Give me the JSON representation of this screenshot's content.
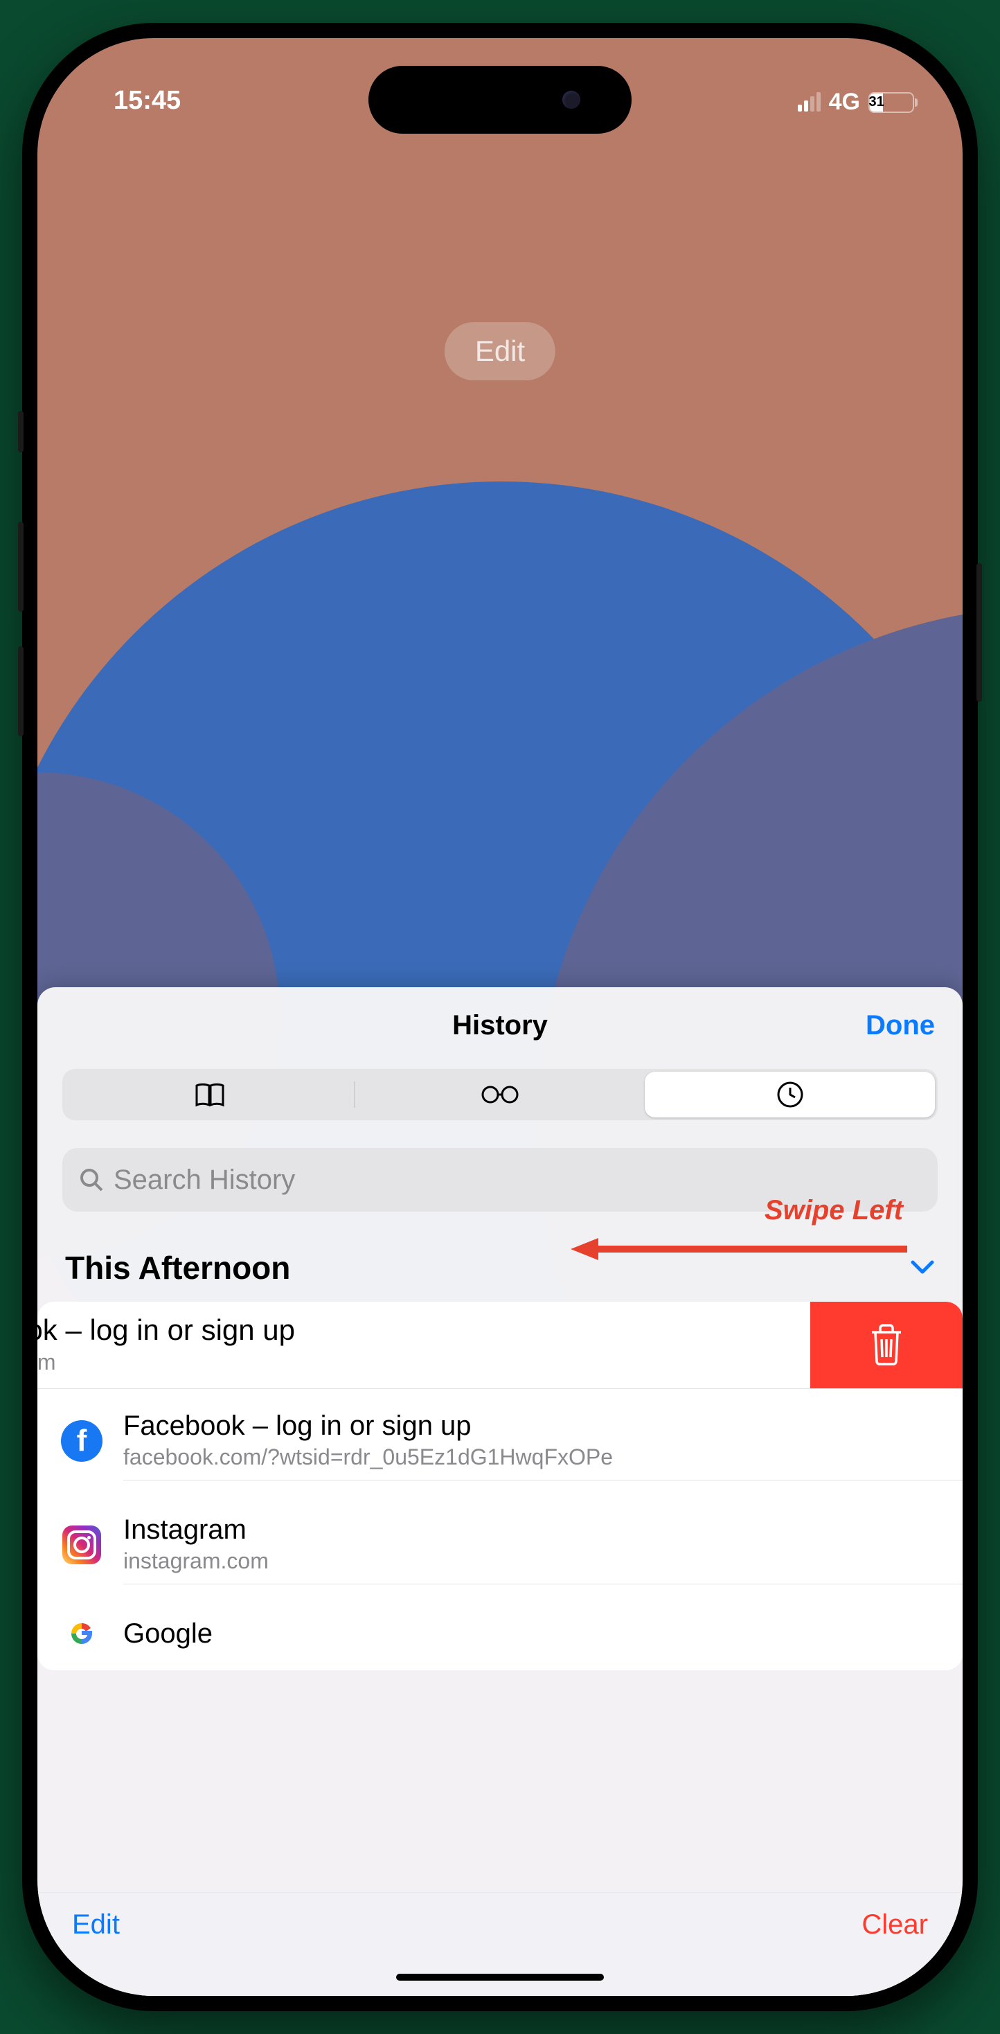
{
  "status": {
    "time": "15:45",
    "network": "4G",
    "battery_pct": "31"
  },
  "wallpaper": {
    "edit_label": "Edit"
  },
  "sheet": {
    "title": "History",
    "done_label": "Done",
    "search_placeholder": "Search History",
    "section_title": "This Afternoon"
  },
  "annotation": {
    "label": "Swipe Left"
  },
  "history": {
    "swiped": {
      "title": "acebook – log in or sign up",
      "subtitle": "ebook.com"
    },
    "items": [
      {
        "title": "Facebook – log in or sign up",
        "subtitle": "facebook.com/?wtsid=rdr_0u5Ez1dG1HwqFxOPe",
        "icon": "facebook"
      },
      {
        "title": "Instagram",
        "subtitle": "instagram.com",
        "icon": "instagram"
      },
      {
        "title": "Google",
        "subtitle": "",
        "icon": "google"
      }
    ]
  },
  "bottombar": {
    "edit_label": "Edit",
    "clear_label": "Clear"
  }
}
